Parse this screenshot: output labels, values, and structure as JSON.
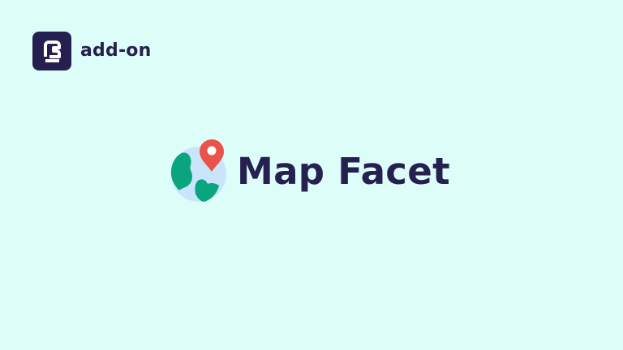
{
  "badge": {
    "label": "add-on",
    "logo_icon": "brand-logo-icon"
  },
  "hero": {
    "title": "Map Facet",
    "icon": "globe-with-location-pin-icon"
  },
  "colors": {
    "background": "#dcfdf8",
    "text": "#25204f",
    "globe_water": "#c9e4fb",
    "globe_land": "#0aa57e",
    "pin": "#e9534b"
  }
}
